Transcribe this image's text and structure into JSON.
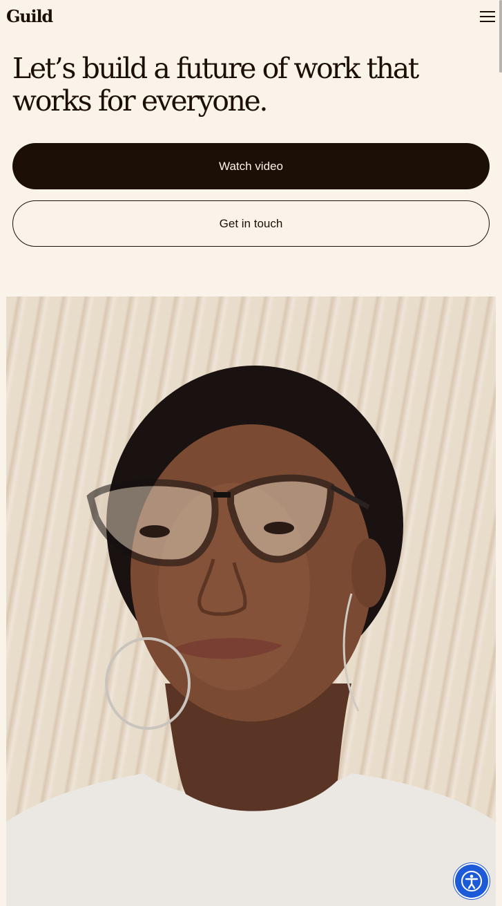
{
  "header": {
    "logo_text": "Guild",
    "menu_icon": "hamburger-menu-icon"
  },
  "hero": {
    "title": "Let’s build a future of work that works for everyone.",
    "primary_button_label": "Watch video",
    "secondary_button_label": "Get in touch"
  },
  "image": {
    "description_icon": "portrait-photo"
  },
  "accessibility": {
    "icon": "accessibility-person-icon"
  },
  "colors": {
    "background": "#faf3ea",
    "text": "#1c0f06",
    "accessibility_button": "#1d5ad8"
  }
}
